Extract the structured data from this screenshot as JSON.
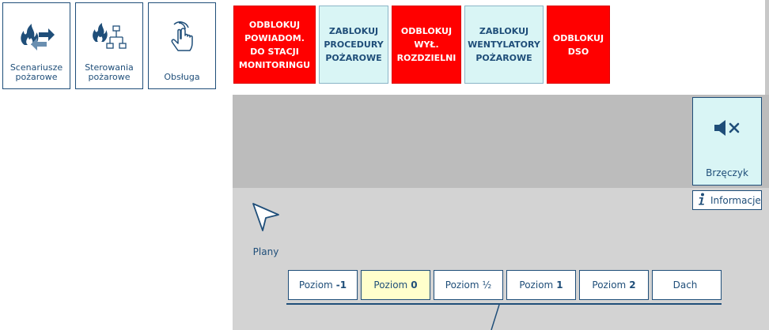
{
  "tiles": [
    {
      "label": "Scenariusze pożarowe",
      "icon": "fire-transfer-icon"
    },
    {
      "label": "Sterowania pożarowe",
      "icon": "fire-network-icon"
    },
    {
      "label": "Obsługa",
      "icon": "hand-pointer-icon"
    }
  ],
  "actions": [
    {
      "lines": [
        "ODBLOKUJ",
        "POWIADOM.",
        "DO STACJI",
        "MONITORINGU"
      ],
      "style": "red"
    },
    {
      "lines": [
        "ZABLOKUJ",
        "PROCEDURY",
        "POŻAROWE"
      ],
      "style": "cyan"
    },
    {
      "lines": [
        "ODBLOKUJ",
        "WYŁ.",
        "ROZDZIELNI"
      ],
      "style": "red"
    },
    {
      "lines": [
        "ZABLOKUJ",
        "WENTYLATORY",
        "POŻAROWE"
      ],
      "style": "cyan"
    },
    {
      "lines": [
        "ODBLOKUJ",
        "DSO"
      ],
      "style": "red"
    }
  ],
  "buzzer": {
    "label": "Brzęczyk",
    "icon": "speaker-mute-icon"
  },
  "info": {
    "label": "Informacje",
    "icon": "info-icon"
  },
  "plans": {
    "label": "Plany",
    "icon": "cursor-arrow-icon"
  },
  "levels": [
    {
      "prefix": "Poziom",
      "num": "-1",
      "active": false
    },
    {
      "prefix": "Poziom",
      "num": "0",
      "active": true
    },
    {
      "prefix": "Poziom",
      "num": "½",
      "active": false
    },
    {
      "prefix": "Poziom",
      "num": "1",
      "active": false
    },
    {
      "prefix": "Poziom",
      "num": "2",
      "active": false
    },
    {
      "prefix": "Dach",
      "num": "",
      "active": false
    }
  ],
  "colors": {
    "accent": "#1f4e79",
    "alarm_red": "#ff0000",
    "cyan": "#d9f5f5",
    "active_level": "#ffffcc"
  }
}
